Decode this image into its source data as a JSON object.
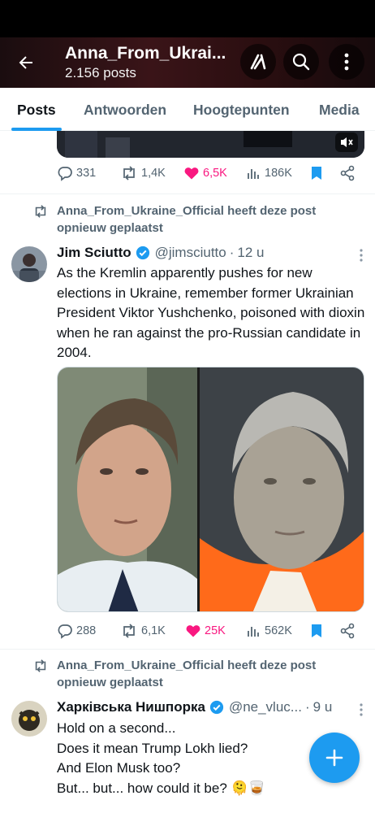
{
  "header": {
    "title": "Anna_From_Ukrai...",
    "post_count": "2.156 posts"
  },
  "tabs": [
    "Posts",
    "Antwoorden",
    "Hoogtepunten",
    "Media"
  ],
  "post1": {
    "replies": "331",
    "reposts": "1,4K",
    "likes": "6,5K",
    "views": "186K"
  },
  "post2": {
    "repost_label": "Anna_From_Ukraine_Official heeft deze post opnieuw geplaatst",
    "author_name": "Jim Sciutto",
    "author_handle": "@jimsciutto",
    "time": "12 u",
    "text": "As the Kremlin apparently pushes for new elections in Ukraine, remember former Ukrainian President Viktor Yushchenko, poisoned with dioxin when he ran against the pro-Russian candidate in 2004.",
    "replies": "288",
    "reposts": "6,1K",
    "likes": "25K",
    "views": "562K"
  },
  "post3": {
    "repost_label": "Anna_From_Ukraine_Official heeft deze post opnieuw geplaatst",
    "author_name": "Харківська Нишпорка",
    "author_handle": "@ne_vluc...",
    "time": "9 u",
    "lines": [
      "Hold on a second...",
      "Does it mean Trump Lokh lied?",
      "And Elon Musk too?",
      "But... but... how could it be? 🫠🥃"
    ]
  },
  "colors": {
    "accent": "#1d9bf0",
    "like": "#f91880",
    "muted": "#536471"
  },
  "icons": [
    "back-arrow-icon",
    "grok-icon",
    "search-icon",
    "more-vertical-icon",
    "mute-icon",
    "reply-icon",
    "repost-icon",
    "heart-icon",
    "views-icon",
    "bookmark-icon",
    "share-icon",
    "verified-icon",
    "plus-icon"
  ]
}
